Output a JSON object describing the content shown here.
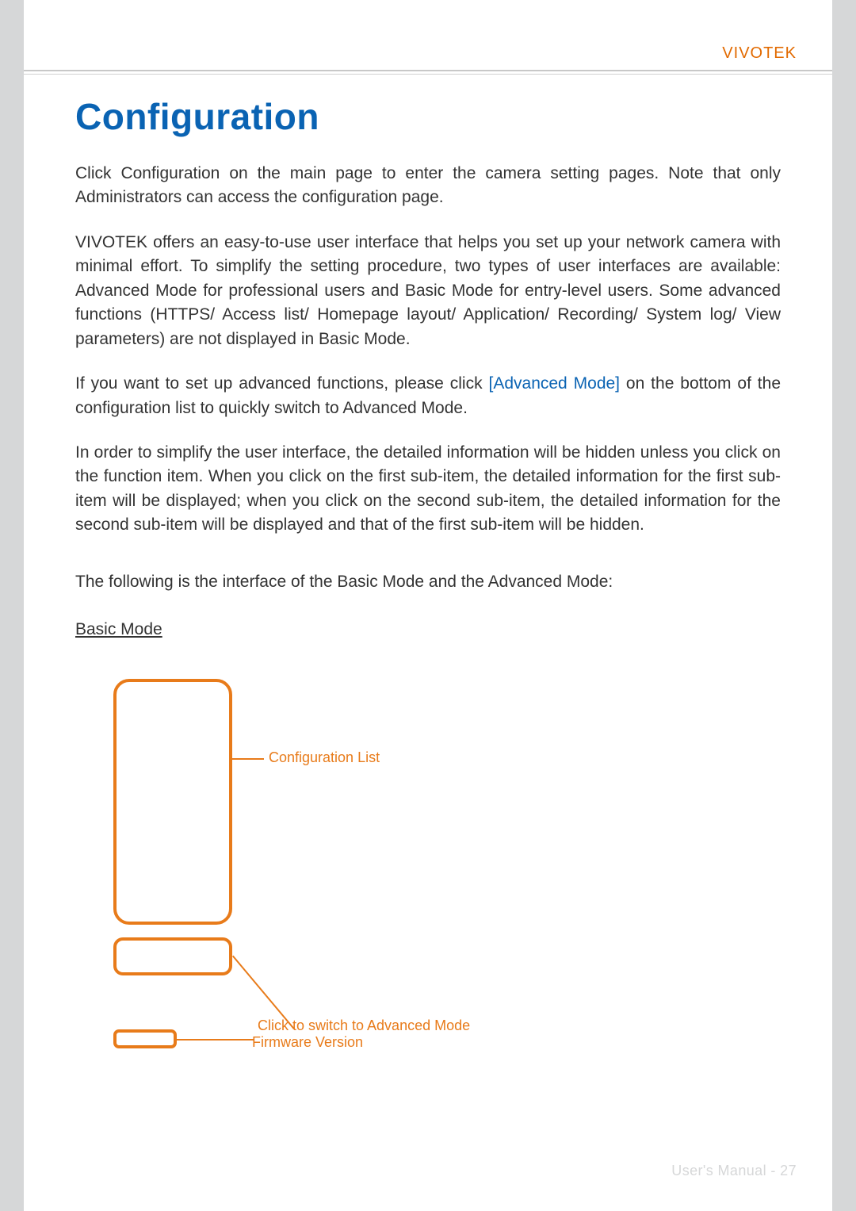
{
  "header": {
    "brand": "VIVOTEK"
  },
  "title": "Configuration",
  "paragraphs": {
    "p1": "Click Configuration  on the main page to enter the camera setting pages. Note that only Administrators can access the configuration page.",
    "p2": "VIVOTEK offers an easy-to-use user interface that helps you set up your network camera with minimal effort. To simplify the setting procedure, two types of user interfaces are available: Advanced Mode for professional users and Basic Mode for entry-level users. Some advanced functions (HTTPS/ Access list/ Homepage layout/ Application/ Recording/ System log/ View parameters) are not displayed in Basic Mode.",
    "p3a": "If you want to set up advanced functions, please click ",
    "p3_link": "[Advanced Mode]",
    "p3b": "  on the bottom of the configuration list to quickly switch to Advanced Mode.",
    "p4": "In order to simplify the user interface, the detailed information will be hidden unless you click on the function item. When you click on the first sub-item, the detailed information for the first sub-item will be displayed; when you click on the second sub-item, the detailed information for the second sub-item will be displayed and that of the first sub-item will be hidden."
  },
  "section_intro": "The following is the interface of the Basic Mode and the Advanced Mode:",
  "subheading": "Basic Mode",
  "diagram": {
    "config_list_label": "Configuration List",
    "switch_label": "Click to switch to Advanced Mode",
    "firmware_label": "Firmware Version"
  },
  "footer": {
    "text": "User's Manual - 27"
  },
  "colors": {
    "accent_blue": "#0a63b3",
    "accent_orange": "#e87b1a",
    "brand_orange": "#e26a00"
  }
}
